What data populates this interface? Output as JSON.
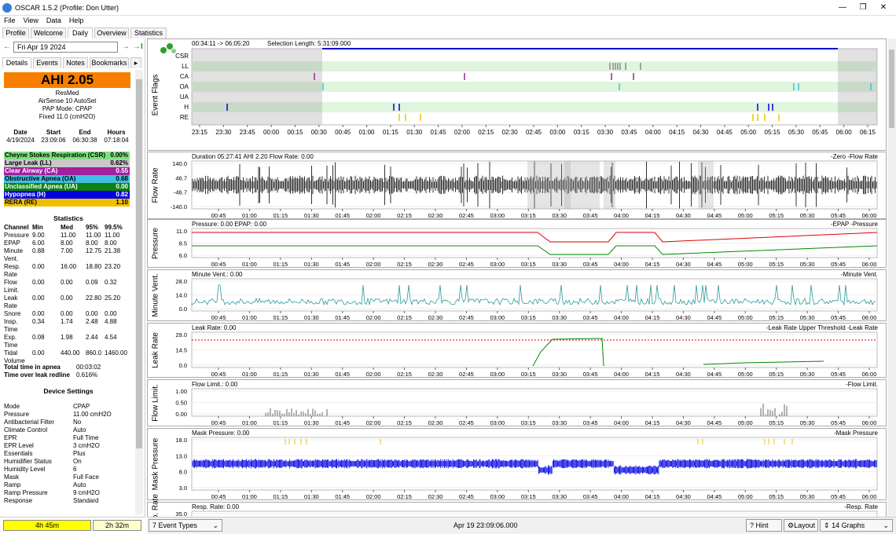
{
  "window": {
    "title": "OSCAR 1.5.2 (Profile: Don Utter)",
    "min": "—",
    "max": "❐",
    "close": "✕"
  },
  "menu": [
    "File",
    "View",
    "Data",
    "Help"
  ],
  "tabs": [
    "Profile",
    "Welcome",
    "Daily",
    "Overview",
    "Statistics"
  ],
  "datenav": {
    "prev": "←",
    "date": "Fri Apr 19 2024",
    "next": "→",
    "last": "→I"
  },
  "left_tabs": [
    "Details",
    "Events",
    "Notes",
    "Bookmarks"
  ],
  "ahi": {
    "label": "AHI 2.05",
    "color": "#f77f00"
  },
  "machine": {
    "brand": "ResMed",
    "model": "AirSense 10 AutoSet",
    "mode": "PAP Mode: CPAP",
    "pressure": "Fixed 11.0 (cmH2O)"
  },
  "session": {
    "headers": [
      "Date",
      "Start",
      "End",
      "Hours"
    ],
    "values": [
      "4/19/2024",
      "23:09:06",
      "06:30:38",
      "07:18:04"
    ]
  },
  "events": [
    {
      "name": "Cheyne Stokes Respiration (CSR)",
      "value": "0.00%",
      "color": "#80e080",
      "text": "#000"
    },
    {
      "name": "Large Leak (LL)",
      "value": "0.62%",
      "color": "#c8c8c8",
      "text": "#000"
    },
    {
      "name": "Clear Airway (CA)",
      "value": "0.55",
      "color": "#a020a0",
      "text": "#fff"
    },
    {
      "name": "Obstructive Apnea (OA)",
      "value": "0.68",
      "color": "#40c0e0",
      "text": "#000"
    },
    {
      "name": "Unclassified Apnea (UA)",
      "value": "0.00",
      "color": "#108010",
      "text": "#fff"
    },
    {
      "name": "Hypopnea (H)",
      "value": "0.82",
      "color": "#0000e0",
      "text": "#fff"
    },
    {
      "name": "RERA (RE)",
      "value": "1.10",
      "color": "#f0c000",
      "text": "#000"
    }
  ],
  "statistics": {
    "title": "Statistics",
    "headers": [
      "Channel",
      "Min",
      "Med",
      "95%",
      "99.5%"
    ],
    "rows": [
      [
        "Pressure",
        "9.00",
        "11.00",
        "11.00",
        "11.00"
      ],
      [
        "EPAP",
        "6.00",
        "8.00",
        "8.00",
        "8.00"
      ],
      [
        "Minute Vent.",
        "0.88",
        "7.00",
        "12.75",
        "21.38"
      ],
      [
        "Resp. Rate",
        "0.00",
        "16.00",
        "18.80",
        "23.20"
      ],
      [
        "Flow Limit.",
        "0.00",
        "0.00",
        "0.09",
        "0.32"
      ],
      [
        "Leak Rate",
        "0.00",
        "0.00",
        "22.80",
        "25.20"
      ],
      [
        "Snore",
        "0.00",
        "0.00",
        "0.00",
        "0.00"
      ],
      [
        "Insp. Time",
        "0.34",
        "1.74",
        "2.48",
        "4.88"
      ],
      [
        "Exp. Time",
        "0.08",
        "1.98",
        "2.44",
        "4.54"
      ],
      [
        "Tidal Volume",
        "0.00",
        "440.00",
        "860.0",
        "1460.00"
      ]
    ],
    "total_apnea_label": "Total time in apnea",
    "total_apnea": "00:03:02",
    "over_leak_label": "Time over leak redline",
    "over_leak": "0.616%"
  },
  "device": {
    "title": "Device Settings",
    "rows": [
      [
        "Mode",
        "CPAP"
      ],
      [
        "Pressure",
        "11.00 cmH2O"
      ],
      [
        "Antibacterial Filter",
        "No"
      ],
      [
        "Climate Control",
        "Auto"
      ],
      [
        "EPR",
        "Full Time"
      ],
      [
        "EPR Level",
        "3 cmH2O"
      ],
      [
        "Essentials",
        "Plus"
      ],
      [
        "Humidifier Status",
        "On"
      ],
      [
        "Humidity Level",
        "6"
      ],
      [
        "Mask",
        "Full Face"
      ],
      [
        "Ramp",
        "Auto"
      ],
      [
        "Ramp Pressure",
        "9 cmH2O"
      ],
      [
        "Response",
        "Standard"
      ]
    ]
  },
  "bottom_left": {
    "time1": "4h 45m",
    "time2": "2h 32m"
  },
  "event_flags": {
    "ylabel": "Event Flags",
    "range": "00:34:11 -> 06:05:20",
    "selection": "Selection Length: 5:31:09.000",
    "rows": [
      "CSR",
      "LL",
      "CA",
      "OA",
      "UA",
      "H",
      "RE"
    ],
    "ticks": [
      "23:15",
      "23:30",
      "23:45",
      "00:00",
      "00:15",
      "00:30",
      "00:45",
      "01:00",
      "01:15",
      "01:30",
      "01:45",
      "02:00",
      "02:15",
      "02:30",
      "02:45",
      "03:00",
      "03:15",
      "03:30",
      "03:45",
      "04:00",
      "04:15",
      "04:30",
      "04:45",
      "05:00",
      "05:15",
      "05:30",
      "05:45",
      "06:00",
      "06:15"
    ]
  },
  "time_ticks": [
    "00:45",
    "01:00",
    "01:15",
    "01:30",
    "01:45",
    "02:00",
    "02:15",
    "02:30",
    "02:45",
    "03:00",
    "03:15",
    "03:30",
    "03:45",
    "04:00",
    "04:15",
    "04:30",
    "04:45",
    "05:00",
    "05:15",
    "05:30",
    "05:45",
    "06:00"
  ],
  "panels": [
    {
      "ylabel": "Flow Rate",
      "head": "Duration 05:27:41 AHI 2.20 Flow Rate: 0.00",
      "legend": "-Zero -Flow Rate",
      "yticks": [
        "140.0",
        "46.7",
        "-46.7",
        "-140.0"
      ]
    },
    {
      "ylabel": "Pressure",
      "head": "Pressure: 0.00 EPAP: 0.00",
      "legend": "-EPAP -Pressure",
      "yticks": [
        "11.0",
        "8.5",
        "6.0"
      ]
    },
    {
      "ylabel": "Minute Vent.",
      "head": "Minute Vent.: 0.00",
      "legend": "-Minute Vent.",
      "yticks": [
        "28.0",
        "14.0",
        "0.0"
      ]
    },
    {
      "ylabel": "Leak Rate",
      "head": "Leak Rate: 0.00",
      "legend": "-Leak Rate Upper Threshold -Leak Rate",
      "yticks": [
        "29.0",
        "14.5",
        "0.0"
      ]
    },
    {
      "ylabel": "Flow Limit.",
      "head": "Flow Limit.: 0.00",
      "legend": "-Flow Limit.",
      "yticks": [
        "1.00",
        "0.50",
        "0.00"
      ]
    },
    {
      "ylabel": "Mask Pressure",
      "head": "Mask Pressure: 0.00",
      "legend": "-Mask Pressure",
      "yticks": [
        "18.0",
        "13.0",
        "8.0",
        "3.0"
      ]
    },
    {
      "ylabel": "Resp. Rate",
      "head": "Resp. Rate: 0.00",
      "legend": "-Resp. Rate",
      "yticks": [
        "35.0"
      ]
    }
  ],
  "status": {
    "event_types": "7 Event Types",
    "datetime": "Apr 19 23:09:06.000",
    "hint": "Hint",
    "layout": "Layout",
    "graphs": "14 Graphs"
  }
}
